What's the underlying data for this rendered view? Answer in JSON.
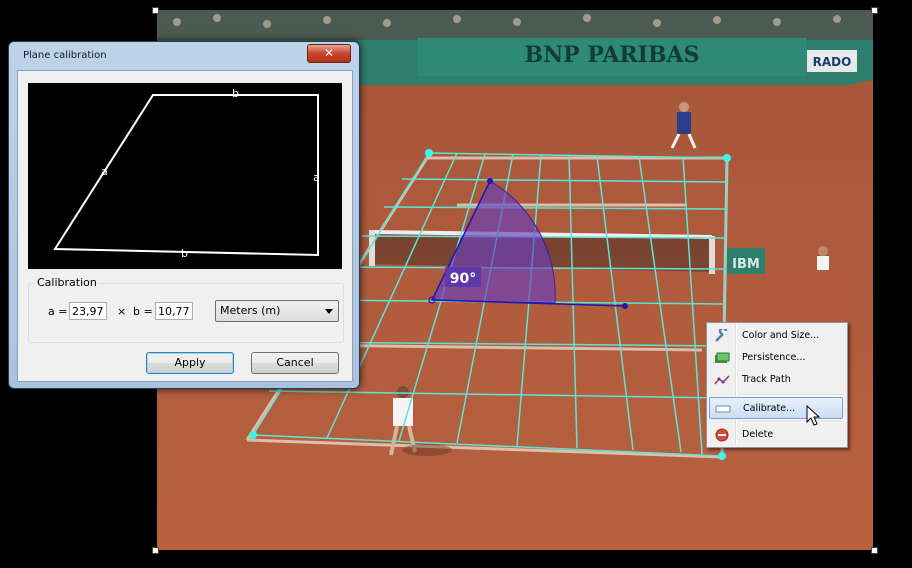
{
  "dialog": {
    "title": "Plane calibration",
    "close_glyph": "✕",
    "preview": {
      "label_a_left": "a",
      "label_a_right": "a",
      "label_b_top": "b",
      "label_b_bottom": "b"
    },
    "calibration": {
      "group_label": "Calibration",
      "a_label": "a =",
      "a_value": "23,97",
      "times": "×",
      "b_label": "b =",
      "b_value": "10,77",
      "unit_selected": "Meters (m)"
    },
    "apply_label": "Apply",
    "cancel_label": "Cancel"
  },
  "video": {
    "banner_text": "BNP PARIBAS",
    "angle_label": "90°",
    "sponsor_ibm": "IBM",
    "sponsor_rado": "RADO"
  },
  "context_menu": {
    "items": [
      {
        "label": "Color and Size...",
        "icon": "wrench-icon"
      },
      {
        "label": "Persistence...",
        "icon": "layers-icon"
      },
      {
        "label": "Track Path",
        "icon": "track-path-icon"
      },
      {
        "label": "Calibrate...",
        "icon": "ruler-icon",
        "selected": true
      },
      {
        "label": "Delete",
        "icon": "delete-icon"
      }
    ]
  },
  "colors": {
    "grid": "#5fe3d6",
    "angle_fill": "#6a3fc0",
    "clay": "#b35a3c",
    "dialog_frame": "#bcd3ea",
    "highlight": "#c9def5"
  }
}
